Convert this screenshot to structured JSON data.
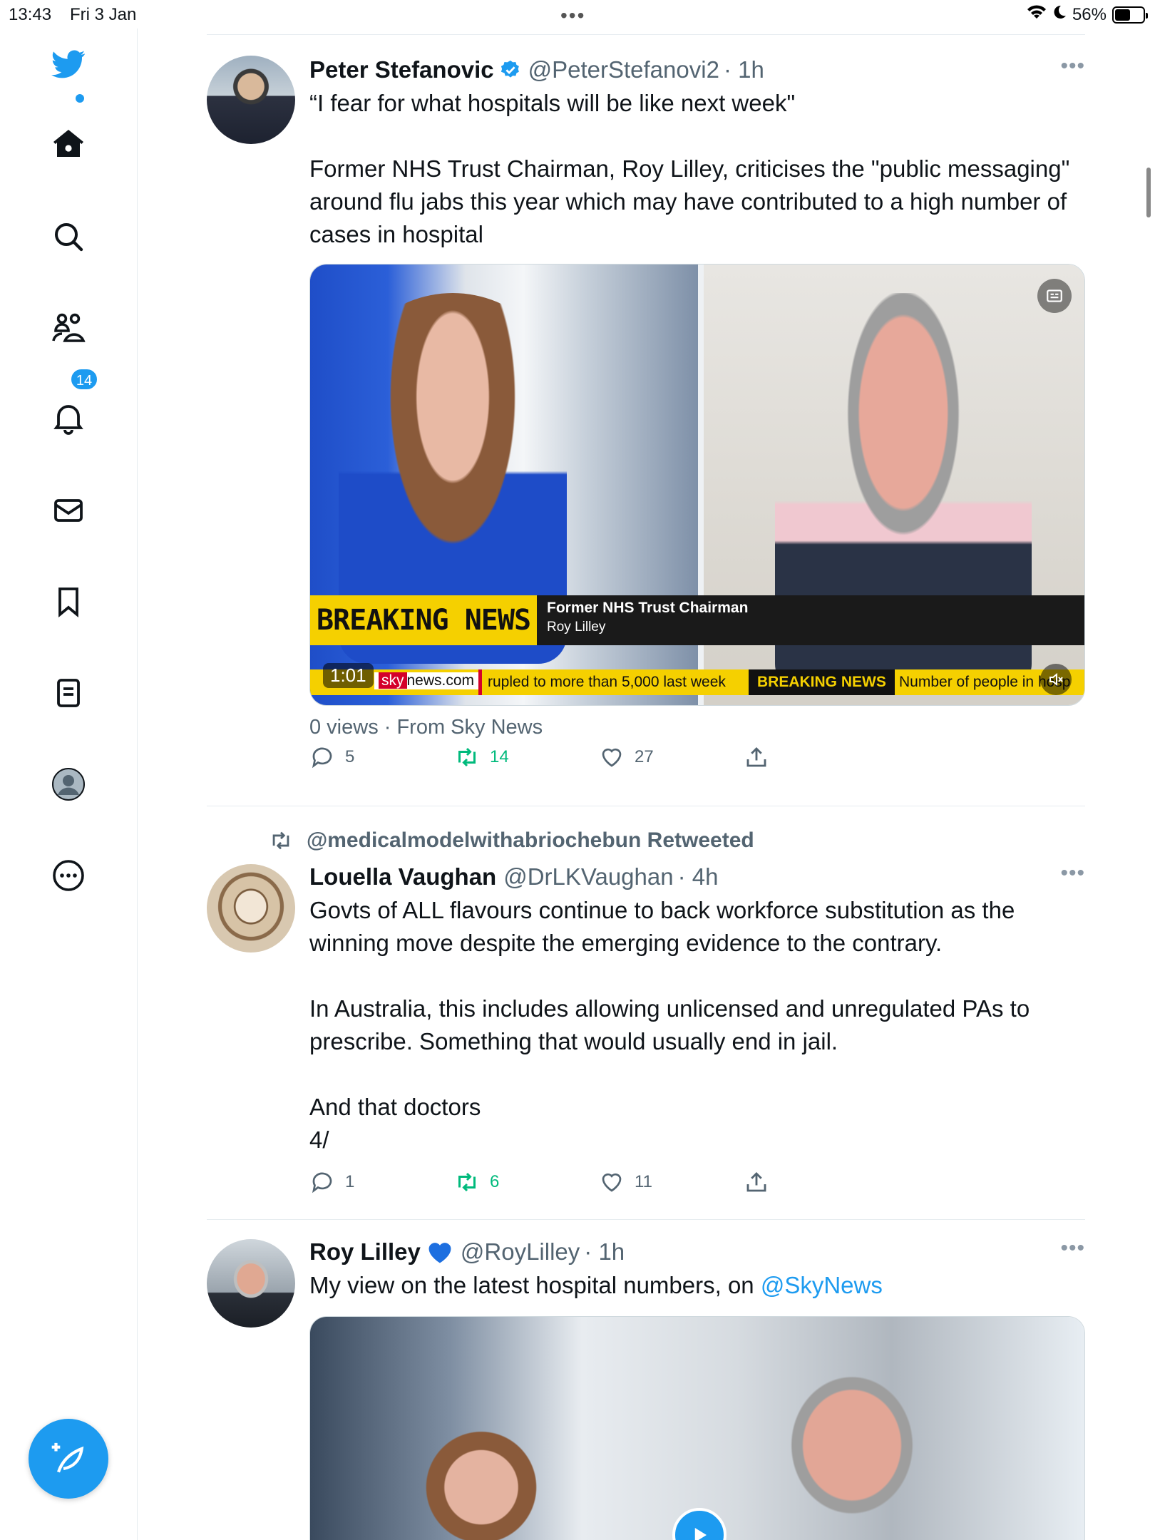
{
  "status_bar": {
    "time": "13:43",
    "date": "Fri 3 Jan",
    "battery": "56%",
    "battery_level": 0.56
  },
  "sidebar": {
    "notification_count": "14",
    "items": [
      "home-icon",
      "search-icon",
      "communities-icon",
      "notifications-icon",
      "messages-icon",
      "bookmarks-icon",
      "lists-icon",
      "profile-icon",
      "more-icon"
    ]
  },
  "colors": {
    "accent": "#1d9bf0",
    "retweet": "#00ba7c",
    "secondary_text": "#536471",
    "breaking_yellow": "#f5d000"
  },
  "tweets": [
    {
      "name": "Peter Stefanovic",
      "verified": true,
      "handle": "@PeterStefanovi2",
      "time": "· 1h",
      "text": "“I fear for what hospitals will be like next week\"\n\nFormer NHS Trust Chairman, Roy Lilley, criticises the \"public messaging\" around flu jabs this year which may have contributed to a high number of cases in hospital",
      "media": {
        "breaking": "BREAKING NEWS",
        "lower_third_title": "Former NHS Trust Chairman",
        "lower_third_name": "Roy Lilley",
        "ticker_site": "news.com",
        "ticker_text1": "rupled to more than 5,000 last week",
        "ticker_breaking": "BREAKING NEWS",
        "ticker_text2": "Number of people in hosp",
        "duration": "1:01"
      },
      "meta": "0 views · From Sky News",
      "replies": "5",
      "retweets": "14",
      "likes": "27"
    },
    {
      "retweeted_by": "@medicalmodelwithabriochebun Retweeted",
      "name": "Louella Vaughan",
      "handle": "@DrLKVaughan",
      "time": "· 4h",
      "text": "Govts of ALL flavours continue to back workforce substitution as the winning move despite the emerging evidence to the contrary.\n\nIn Australia, this includes allowing unlicensed and unregulated PAs to prescribe. Something that would usually end in jail.\n\nAnd that doctors\n4/",
      "replies": "1",
      "retweets": "6",
      "likes": "11"
    },
    {
      "name": "Roy Lilley",
      "handle": "@RoyLilley",
      "time": "· 1h",
      "text_prefix": "My view on the latest hospital numbers, on ",
      "mention": "@SkyNews"
    }
  ]
}
